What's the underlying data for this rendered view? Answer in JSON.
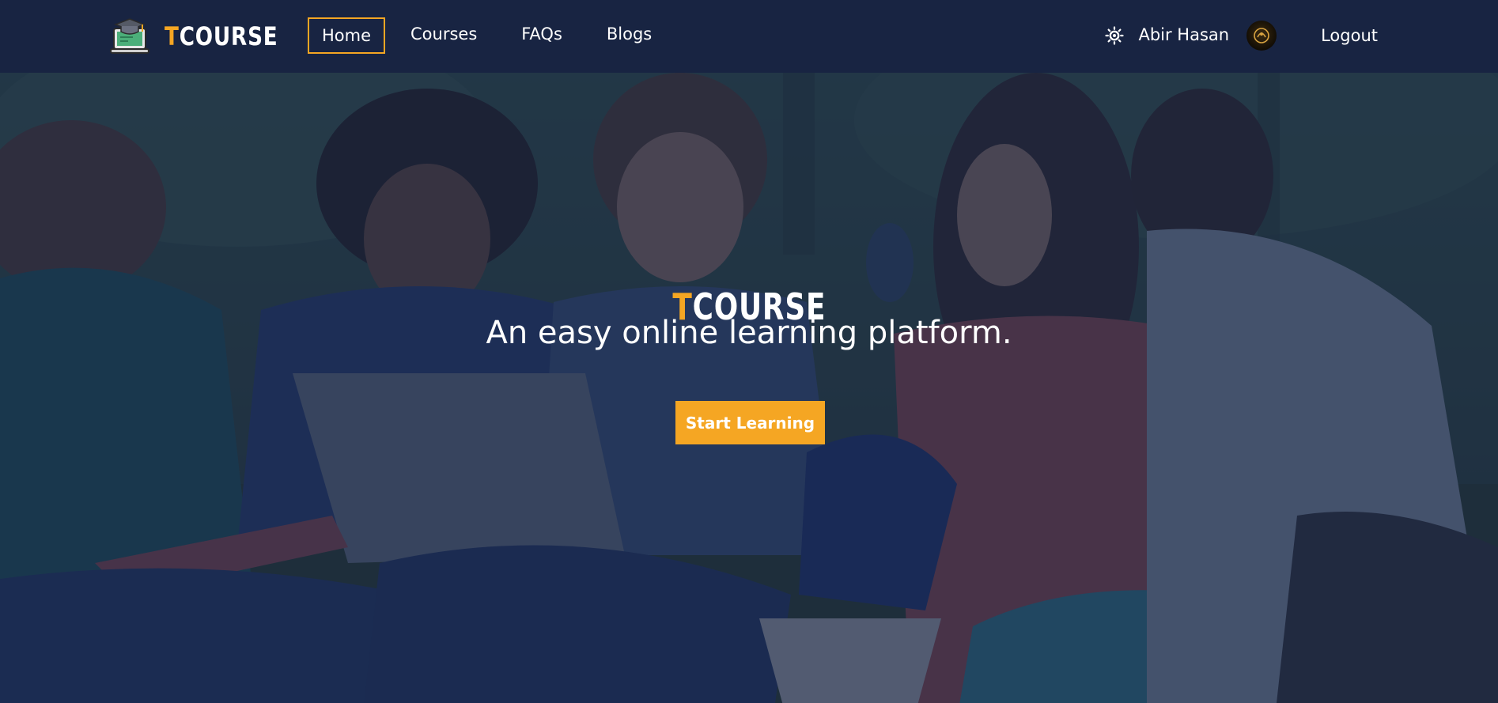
{
  "colors": {
    "navbar_bg": "#182442",
    "accent": "#f5a623",
    "text": "#ffffff",
    "hero_overlay": "rgba(24,36,66,0.72)"
  },
  "navbar": {
    "brand": {
      "first_letter": "T",
      "rest": "COURSE",
      "icon": "graduation-laptop-icon"
    },
    "links": [
      {
        "label": "Home",
        "active": true
      },
      {
        "label": "Courses",
        "active": false
      },
      {
        "label": "FAQs",
        "active": false
      },
      {
        "label": "Blogs",
        "active": false
      }
    ],
    "theme_toggle_icon": "sun-icon",
    "user_name": "Abir Hasan",
    "avatar": "user-avatar",
    "logout_label": "Logout"
  },
  "hero": {
    "title_first_letter": "T",
    "title_rest": "COURSE",
    "subtitle": "An easy online learning platform.",
    "cta_label": "Start Learning",
    "background": "students-studying-outdoors-photo"
  }
}
